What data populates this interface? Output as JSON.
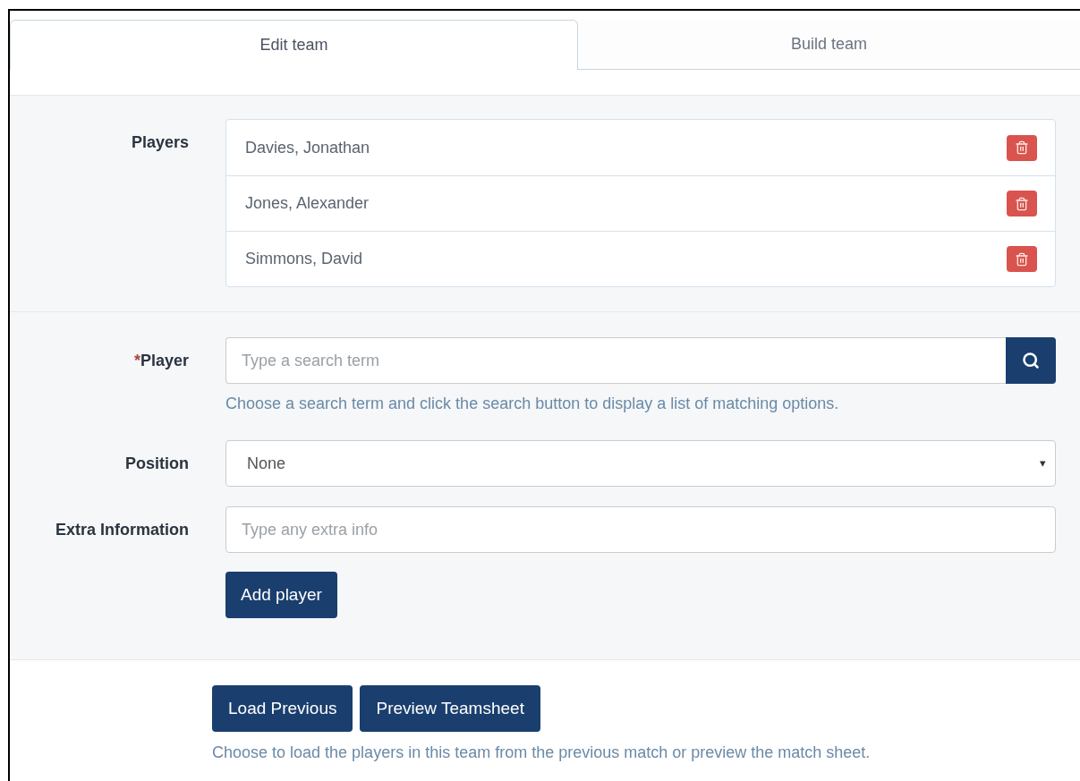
{
  "tabs": [
    {
      "label": "Edit team",
      "selected": true
    },
    {
      "label": "Build team",
      "selected": false
    }
  ],
  "players_section": {
    "label": "Players",
    "players": [
      {
        "name": "Davies, Jonathan"
      },
      {
        "name": "Jones, Alexander"
      },
      {
        "name": "Simmons, David"
      }
    ]
  },
  "form": {
    "player": {
      "required_mark": "*",
      "label": "Player",
      "placeholder": "Type a search term",
      "help": "Choose a search term and click the search button to display a list of matching options."
    },
    "position": {
      "label": "Position",
      "value": "None",
      "caret": "▾"
    },
    "extra": {
      "label": "Extra Information",
      "placeholder": "Type any extra info"
    },
    "add_button": "Add player"
  },
  "footer": {
    "buttons": [
      "Load Previous",
      "Preview Teamsheet"
    ],
    "help": "Choose to load the players in this team from the previous match or preview the match sheet."
  }
}
